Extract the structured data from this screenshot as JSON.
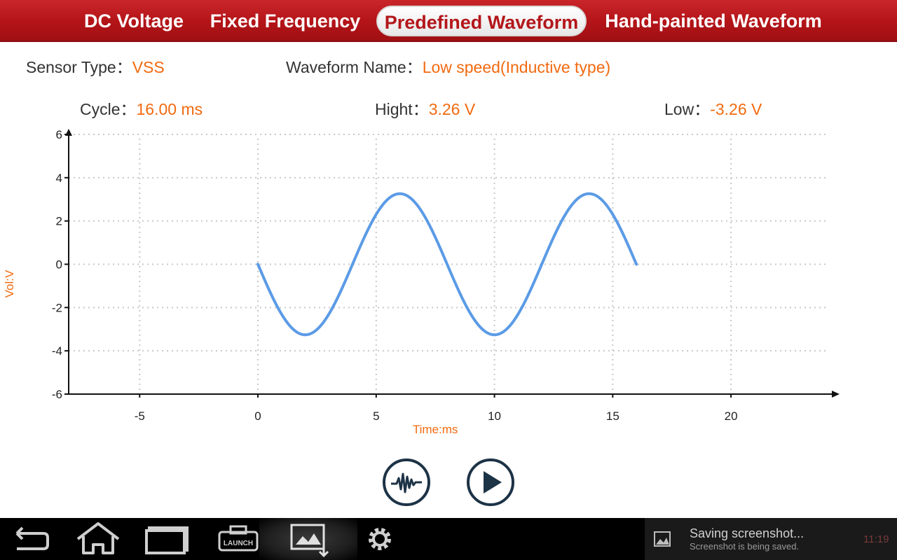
{
  "tabs": [
    {
      "label": "DC Voltage",
      "active": false
    },
    {
      "label": "Fixed Frequency",
      "active": false
    },
    {
      "label": "Predefined Waveform",
      "active": true
    },
    {
      "label": "Hand-painted Waveform",
      "active": false
    }
  ],
  "info": {
    "sensor_type_label": "Sensor Type：",
    "sensor_type_value": "VSS",
    "waveform_name_label": "Waveform Name：",
    "waveform_name_value": "Low speed(Inductive type)",
    "cycle_label": "Cycle：",
    "cycle_value": "16.00 ms",
    "high_label": "Hight：",
    "high_value": "3.26 V",
    "low_label": "Low：",
    "low_value": "-3.26 V"
  },
  "chart_data": {
    "type": "line",
    "xlabel": "Time:ms",
    "ylabel": "Vol:V",
    "xlim": [
      -8,
      24.5
    ],
    "ylim": [
      -6,
      6
    ],
    "xticks": [
      -5,
      0,
      5,
      10,
      15,
      20
    ],
    "yticks": [
      6,
      4,
      2,
      0,
      -2,
      -4,
      -6
    ],
    "grid": true,
    "series": [
      {
        "color": "#5b9be6",
        "amplitude": 3.26,
        "period_ms": 8,
        "x": [
          0,
          1,
          2,
          3,
          4,
          5,
          6,
          7,
          8,
          9,
          10,
          11,
          12,
          13,
          14,
          15,
          16
        ],
        "y": [
          0,
          -2.31,
          -3.26,
          -2.31,
          0,
          2.31,
          3.26,
          2.31,
          0,
          -2.31,
          -3.26,
          -2.31,
          0,
          2.31,
          3.26,
          2.31,
          0
        ]
      }
    ]
  },
  "controls": {
    "waveform_icon": "waveform-icon",
    "play_icon": "play-icon"
  },
  "navbar": {
    "icons": [
      "back-icon",
      "home-icon",
      "recent-apps-icon",
      "launch-icon",
      "screenshot-icon",
      "settings-icon"
    ],
    "launch_label": "LAUNCH",
    "notification_title": "Saving screenshot...",
    "notification_subtitle": "Screenshot is being saved.",
    "clock": "11:19"
  },
  "colors": {
    "tabbar": "#b31418",
    "accent_value": "#f26a10",
    "waveform": "#5b9be6",
    "button_outline": "#1d3346"
  }
}
